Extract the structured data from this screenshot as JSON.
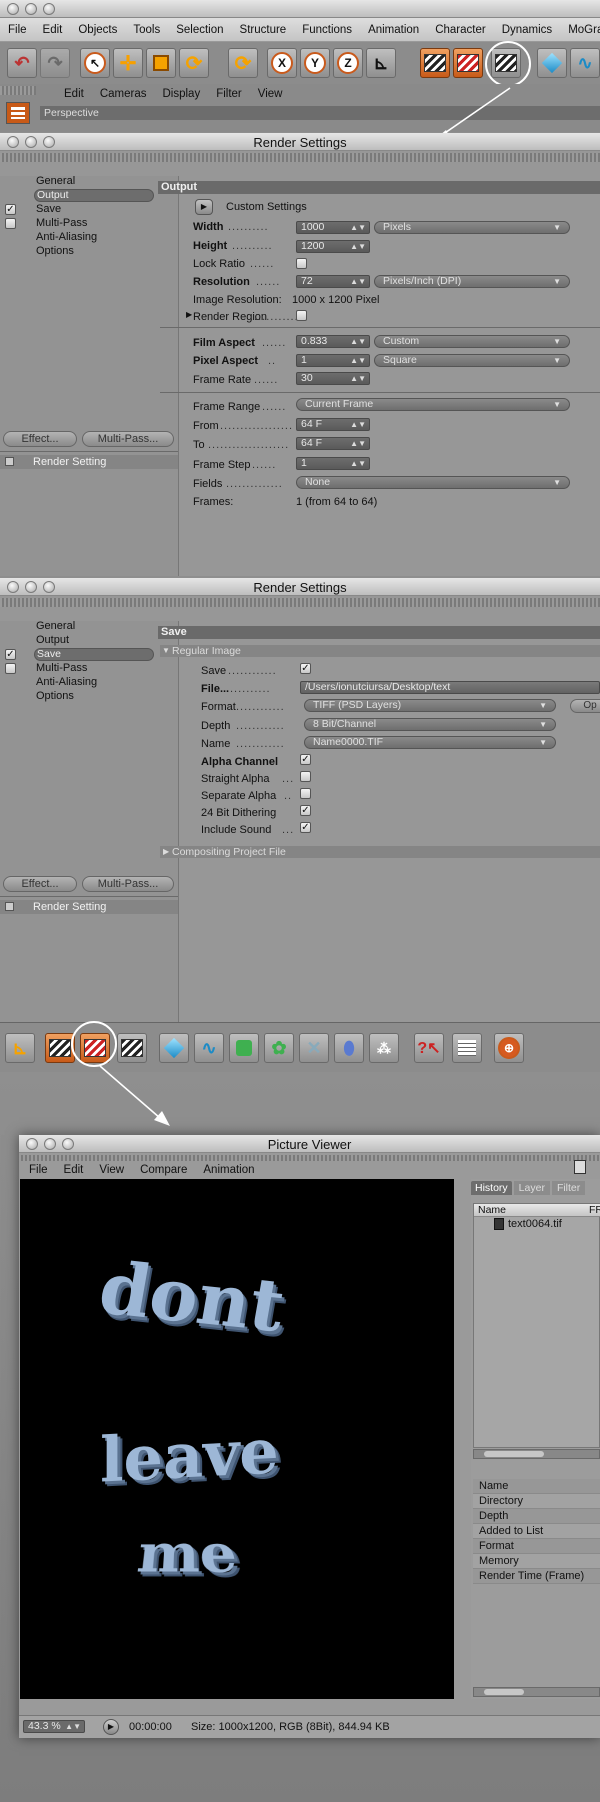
{
  "main_menu": [
    "File",
    "Edit",
    "Objects",
    "Tools",
    "Selection",
    "Structure",
    "Functions",
    "Animation",
    "Character",
    "Dynamics",
    "MoGra"
  ],
  "viewport": {
    "menu": [
      "Edit",
      "Cameras",
      "Display",
      "Filter",
      "View"
    ],
    "label": "Perspective"
  },
  "rs1": {
    "title": "Render Settings",
    "sidebar": [
      "General",
      "Output",
      "Save",
      "Multi-Pass",
      "Anti-Aliasing",
      "Options"
    ],
    "effect_btn": "Effect...",
    "multipass_btn": "Multi-Pass...",
    "render_setting": "Render Setting",
    "section": "Output",
    "custom_settings": "Custom Settings",
    "rows": {
      "width": {
        "label": "Width",
        "value": "1000",
        "unit": "Pixels"
      },
      "height": {
        "label": "Height",
        "value": "1200"
      },
      "lock_ratio": {
        "label": "Lock Ratio"
      },
      "resolution": {
        "label": "Resolution",
        "value": "72",
        "unit": "Pixels/Inch (DPI)"
      },
      "image_resolution": {
        "label": "Image Resolution:",
        "value": "1000 x 1200 Pixel"
      },
      "render_region": {
        "label": "Render Region"
      },
      "film_aspect": {
        "label": "Film Aspect",
        "value": "0.833",
        "preset": "Custom"
      },
      "pixel_aspect": {
        "label": "Pixel Aspect",
        "value": "1",
        "preset": "Square"
      },
      "frame_rate": {
        "label": "Frame Rate",
        "value": "30"
      },
      "frame_range": {
        "label": "Frame Range",
        "value": "Current Frame"
      },
      "from": {
        "label": "From",
        "value": "64 F"
      },
      "to": {
        "label": "To",
        "value": "64 F"
      },
      "frame_step": {
        "label": "Frame Step",
        "value": "1"
      },
      "fields": {
        "label": "Fields",
        "value": "None"
      },
      "frames": {
        "label": "Frames:",
        "value": "1 (from 64 to 64)"
      }
    }
  },
  "rs2": {
    "title": "Render Settings",
    "sidebar": [
      "General",
      "Output",
      "Save",
      "Multi-Pass",
      "Anti-Aliasing",
      "Options"
    ],
    "effect_btn": "Effect...",
    "multipass_btn": "Multi-Pass...",
    "render_setting": "Render Setting",
    "section": "Save",
    "sub": "Regular Image",
    "save": "Save",
    "file": "File...",
    "file_path": "/Users/ionutciursa/Desktop/text",
    "format": "Format",
    "format_value": "TIFF (PSD Layers)",
    "opt_btn": "Op",
    "depth": "Depth",
    "depth_value": "8 Bit/Channel",
    "name": "Name",
    "name_value": "Name0000.TIF",
    "alpha_channel": "Alpha Channel",
    "straight_alpha": "Straight Alpha",
    "separate_alpha": "Separate Alpha",
    "dithering": "24 Bit Dithering",
    "include_sound": "Include Sound",
    "compositing": "Compositing Project File"
  },
  "pv": {
    "title": "Picture Viewer",
    "menu": [
      "File",
      "Edit",
      "View",
      "Compare",
      "Animation"
    ],
    "words": [
      "dont",
      "leave",
      "me"
    ],
    "tabs": [
      "History",
      "Layer",
      "Filter"
    ],
    "col_name": "Name",
    "col_fr": "FR",
    "file": "text0064.tif",
    "info": [
      "Name",
      "Directory",
      "Depth",
      "Added to List",
      "Format",
      "Memory",
      "Render Time (Frame)"
    ],
    "zoom": "43.3 %",
    "time": "00:00:00",
    "size": "Size: 1000x1200, RGB (8Bit), 844.94 KB"
  }
}
